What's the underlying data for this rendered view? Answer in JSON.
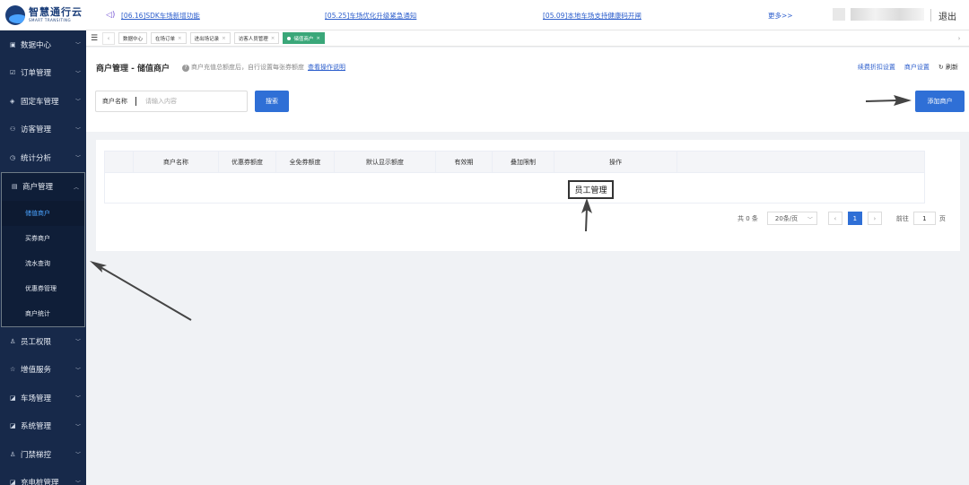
{
  "brand": {
    "name_cn": "智慧通行云",
    "name_en": "SMART TRANSITING"
  },
  "notices": [
    {
      "text": "[06.16]SDK车场新增功能"
    },
    {
      "text": "[05.25]车场优化升级紧急通知"
    },
    {
      "text": "[05.09]本地车场支持健康码开闸"
    }
  ],
  "topbar": {
    "more": "更多>>",
    "logout": "退出"
  },
  "sidebar": {
    "items": [
      {
        "label": "数据中心",
        "icon": "dashboard-icon"
      },
      {
        "label": "订单管理",
        "icon": "order-icon"
      },
      {
        "label": "固定车管理",
        "icon": "car-icon"
      },
      {
        "label": "访客管理",
        "icon": "visitor-icon"
      },
      {
        "label": "统计分析",
        "icon": "stats-icon"
      },
      {
        "label": "商户管理",
        "icon": "merchant-icon",
        "expanded": true
      }
    ],
    "submenu": [
      {
        "label": "储值商户",
        "active": true
      },
      {
        "label": "买券商户"
      },
      {
        "label": "流水查询"
      },
      {
        "label": "优惠券管理"
      },
      {
        "label": "商户统计"
      }
    ],
    "items_after": [
      {
        "label": "员工权限",
        "icon": "staff-icon"
      },
      {
        "label": "增值服务",
        "icon": "star-icon"
      },
      {
        "label": "车场管理",
        "icon": "parking-icon"
      },
      {
        "label": "系统管理",
        "icon": "system-icon"
      },
      {
        "label": "门禁梯控",
        "icon": "door-icon"
      },
      {
        "label": "充电桩管理",
        "icon": "charger-icon"
      }
    ]
  },
  "tabs": [
    {
      "label": "数据中心",
      "closable": false
    },
    {
      "label": "在场订单",
      "closable": true
    },
    {
      "label": "进出场记录",
      "closable": true
    },
    {
      "label": "访客人员管理",
      "closable": true
    },
    {
      "label": "储值商户",
      "closable": true,
      "active": true
    }
  ],
  "page": {
    "title": "商户管理 - 储值商户",
    "hint": "商户充值总额度后，自行设置每张券额度",
    "hint_link": "查看操作说明",
    "links": [
      "续费折扣设置",
      "商户设置"
    ],
    "refresh": "刷新"
  },
  "search": {
    "label": "商户名称",
    "placeholder": "请输入内容",
    "button": "搜索"
  },
  "add_button": "添加商户",
  "table": {
    "columns": [
      "商户名称",
      "优惠券额度",
      "全免券额度",
      "默认显示额度",
      "有效期",
      "叠加限制",
      "操作"
    ]
  },
  "popup_label": "员工管理",
  "pagination": {
    "total": "共 0 条",
    "page_size": "20条/页",
    "current_page": "1",
    "goto_label": "前往",
    "goto_value": "1",
    "goto_unit": "页"
  },
  "colors": {
    "sidebar": "#17294a",
    "primary": "#2f6fd6",
    "active_tab": "#3aa779",
    "link": "#2b5dcc"
  }
}
